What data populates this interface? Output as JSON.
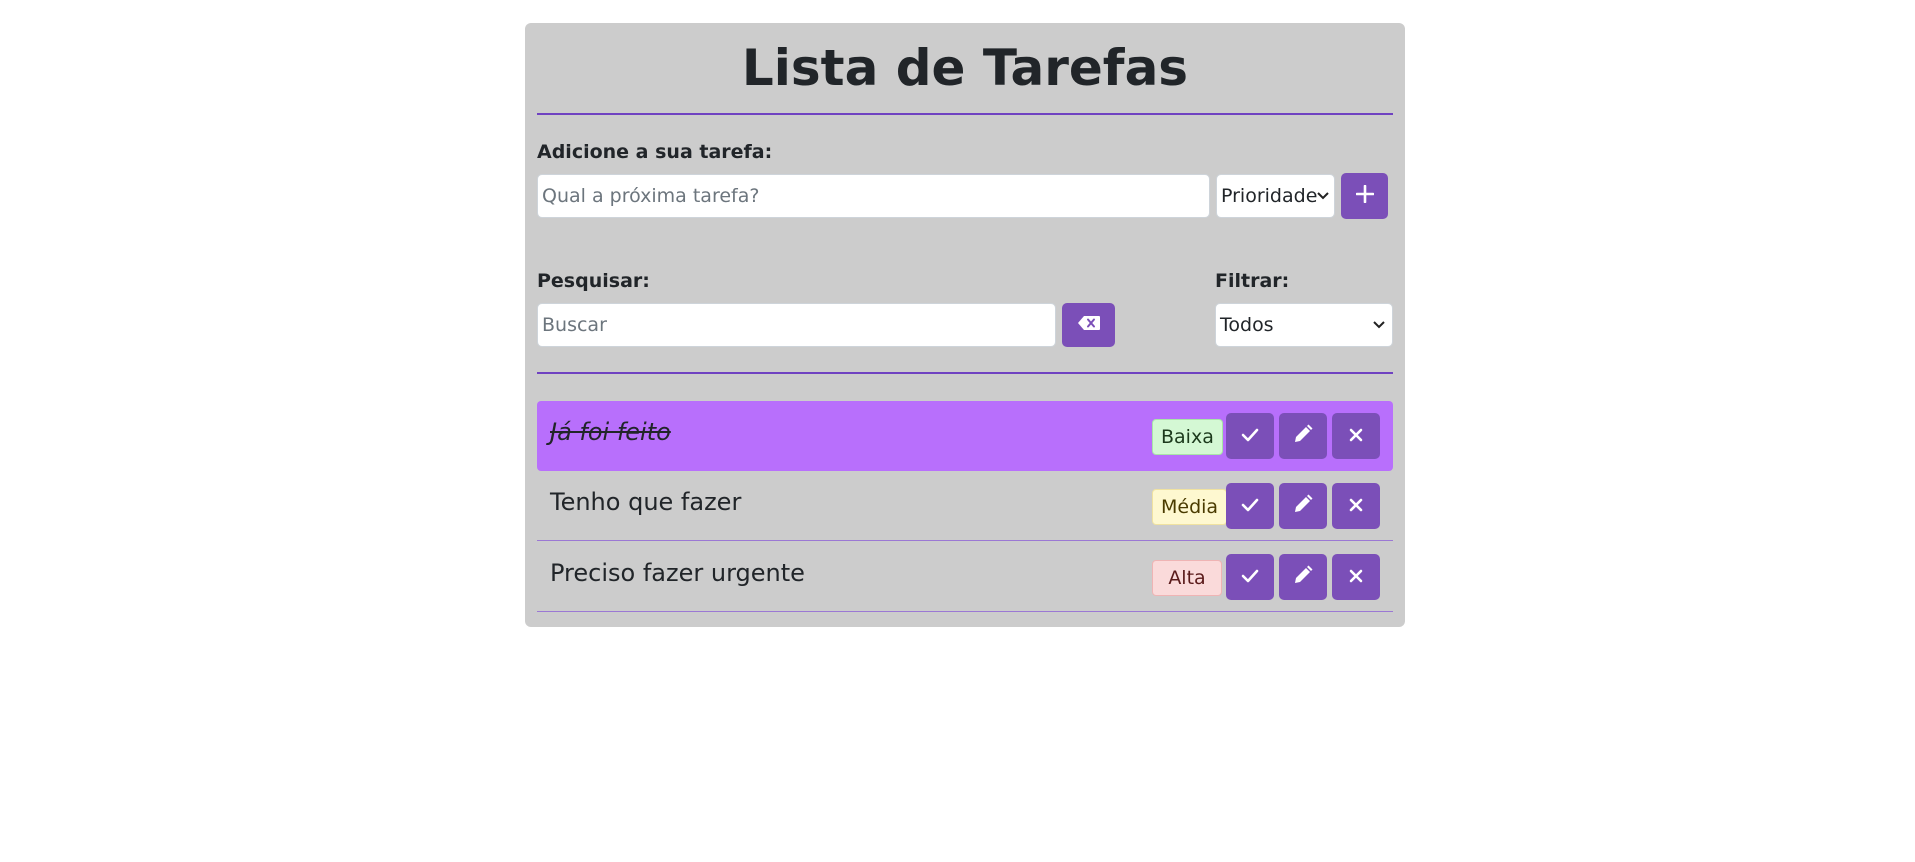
{
  "header": {
    "title": "Lista de Tarefas"
  },
  "add_form": {
    "label": "Adicione a sua tarefa:",
    "placeholder": "Qual a próxima tarefa?",
    "priority_selected": "Prioridade",
    "add_icon": "plus-icon"
  },
  "search": {
    "label": "Pesquisar:",
    "placeholder": "Buscar",
    "clear_icon": "backspace-icon"
  },
  "filter": {
    "label": "Filtrar:",
    "selected": "Todos"
  },
  "todos": [
    {
      "text": "Já foi feito",
      "priority": "Baixa",
      "done": true
    },
    {
      "text": "Tenho que fazer",
      "priority": "Média",
      "done": false
    },
    {
      "text": "Preciso fazer urgente",
      "priority": "Alta",
      "done": false
    }
  ],
  "action_icons": {
    "complete": "check-icon",
    "edit": "pencil-icon",
    "remove": "close-icon"
  },
  "colors": {
    "card_background": "#cccccc",
    "accent": "#7b4fb8",
    "divider": "#6f42c1",
    "done_row": "#b86ffc",
    "priority_low": "#d4f8d4",
    "priority_medium": "#fef8d0",
    "priority_high": "#fadada"
  }
}
